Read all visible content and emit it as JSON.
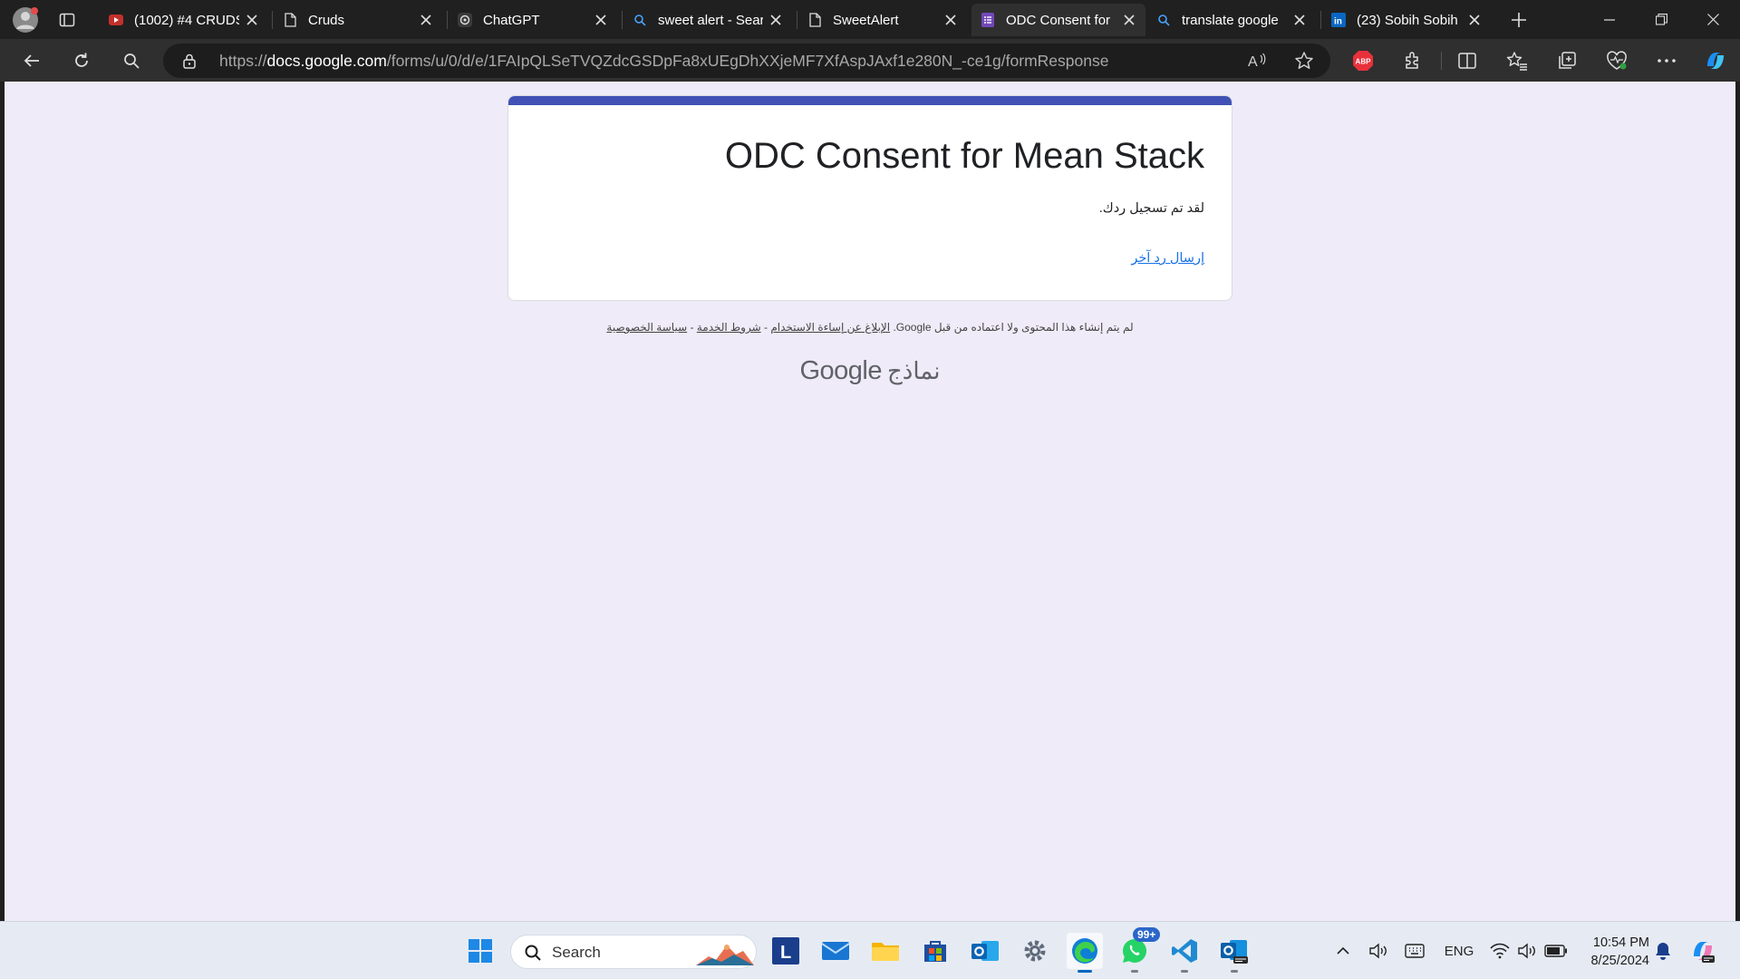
{
  "browser": {
    "tabs": [
      {
        "title": "(1002) #4 CRUDS",
        "icon": "youtube-icon"
      },
      {
        "title": "Cruds",
        "icon": "document-icon"
      },
      {
        "title": "ChatGPT",
        "icon": "chatgpt-icon"
      },
      {
        "title": "sweet alert - Sear",
        "icon": "search-icon"
      },
      {
        "title": "SweetAlert",
        "icon": "document-icon"
      },
      {
        "title": "ODC Consent for",
        "icon": "forms-icon",
        "active": true
      },
      {
        "title": "translate google",
        "icon": "search-icon"
      },
      {
        "title": "(23) Sobih Sobih",
        "icon": "linkedin-icon"
      }
    ],
    "address": {
      "prefix": "https://",
      "host": "docs.google.com",
      "path": "/forms/u/0/d/e/1FAIpQLSeTVQZdcGSDpFa8xUEgDhXXjeMF7XfAspJAxf1e280N_-ce1g/formResponse"
    },
    "extension_badge": "ABP"
  },
  "form": {
    "accent_color": "#4051b5",
    "title": "ODC Consent for Mean Stack",
    "message": "لقد تم تسجيل ردك.",
    "another_response_link": "إرسال رد آخر"
  },
  "footer": {
    "disclaimer": "لم يتم إنشاء هذا المحتوى ولا اعتماده من قبل Google.",
    "report_link": "الإبلاغ عن إساءة الاستخدام",
    "terms_link": "شروط الخدمة",
    "privacy_link": "سياسة الخصوصية",
    "separator": "-",
    "brand_google": "Google",
    "brand_forms": "نماذج"
  },
  "taskbar": {
    "search_placeholder": "Search",
    "whatsapp_badge": "99+",
    "language": "ENG",
    "time": "10:54 PM",
    "date": "8/25/2024"
  }
}
